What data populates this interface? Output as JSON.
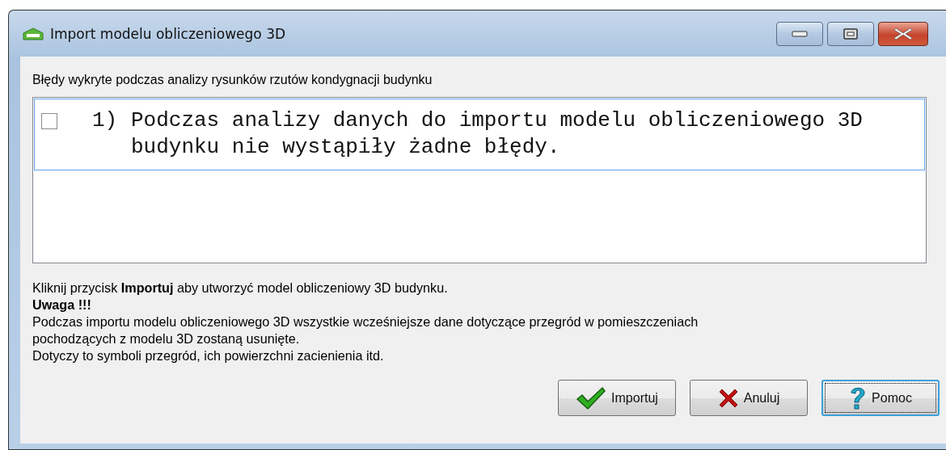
{
  "window": {
    "title": "Import modelu obliczeniowego 3D"
  },
  "errors_label": "Błędy wykryte podczas analizy rysunków rzutów kondygnacji budynku",
  "errors": [
    {
      "number": "1)",
      "text": "Podczas analizy danych do importu modelu obliczeniowego 3D budynku nie wystąpiły żadne błędy.",
      "checked": false,
      "selected": true
    }
  ],
  "info": [
    "Kliknij przycisk **Importuj** aby utworzyć model obliczeniowy 3D budynku."
  ],
  "warning_title": "Uwaga !!!",
  "warning_lines": [
    "Podczas importu modelu obliczeniowego 3D wszystkie wcześniejsze dane dotyczące przegród w pomieszczeniach",
    "pochodzących z modelu 3D zostaną usunięte.",
    "Dotyczy to symboli przegród, ich powierzchni zacienienia itd."
  ],
  "buttons": [
    {
      "kind": "ok",
      "label": "Importuj",
      "focused": false
    },
    {
      "kind": "cancel",
      "label": "Anuluj",
      "focused": false
    },
    {
      "kind": "help",
      "label": "Pomoc",
      "focused": true
    }
  ]
}
